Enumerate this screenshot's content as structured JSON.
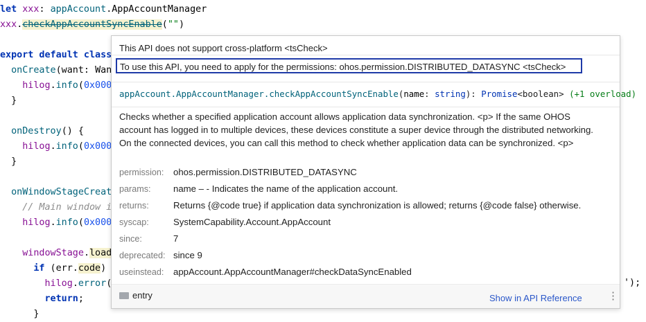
{
  "editor": {
    "lines": [
      {
        "id": "l1",
        "parts": [
          [
            "kw",
            "let "
          ],
          [
            "id",
            "xxx"
          ],
          [
            "plain",
            ": "
          ],
          [
            "fn",
            "appAccount"
          ],
          [
            "plain",
            "."
          ],
          [
            "cls",
            "AppAccountManager"
          ]
        ]
      },
      {
        "id": "l2",
        "parts": [
          [
            "id",
            "xxx"
          ],
          [
            "plain",
            "."
          ],
          [
            "deprecated",
            "checkAppAccountSyncEnable"
          ],
          [
            "plain",
            "("
          ],
          [
            "str",
            "\"\""
          ],
          [
            "plain",
            ")"
          ]
        ]
      },
      {
        "id": "l3",
        "parts": []
      },
      {
        "id": "l4",
        "parts": [
          [
            "kw",
            "export default class"
          ]
        ]
      },
      {
        "id": "l5",
        "parts": [
          [
            "plain",
            "  "
          ],
          [
            "fn",
            "onCreate"
          ],
          [
            "plain",
            "(want: "
          ],
          [
            "cls",
            "Wan"
          ]
        ]
      },
      {
        "id": "l6",
        "parts": [
          [
            "plain",
            "    "
          ],
          [
            "id",
            "hilog"
          ],
          [
            "plain",
            "."
          ],
          [
            "fn",
            "info"
          ],
          [
            "plain",
            "("
          ],
          [
            "num",
            "0x000"
          ]
        ]
      },
      {
        "id": "l7",
        "parts": [
          [
            "plain",
            "  }"
          ]
        ]
      },
      {
        "id": "l8",
        "parts": []
      },
      {
        "id": "l9",
        "parts": [
          [
            "plain",
            "  "
          ],
          [
            "fn",
            "onDestroy"
          ],
          [
            "plain",
            "() {"
          ]
        ]
      },
      {
        "id": "l10",
        "parts": [
          [
            "plain",
            "    "
          ],
          [
            "id",
            "hilog"
          ],
          [
            "plain",
            "."
          ],
          [
            "fn",
            "info"
          ],
          [
            "plain",
            "("
          ],
          [
            "num",
            "0x000"
          ]
        ]
      },
      {
        "id": "l11",
        "parts": [
          [
            "plain",
            "  }"
          ]
        ]
      },
      {
        "id": "l12",
        "parts": []
      },
      {
        "id": "l13",
        "parts": [
          [
            "plain",
            "  "
          ],
          [
            "fn",
            "onWindowStageCreat"
          ]
        ]
      },
      {
        "id": "l14",
        "parts": [
          [
            "plain",
            "    "
          ],
          [
            "cm",
            "// Main window i"
          ]
        ]
      },
      {
        "id": "l15",
        "parts": [
          [
            "plain",
            "    "
          ],
          [
            "id",
            "hilog"
          ],
          [
            "plain",
            "."
          ],
          [
            "fn",
            "info"
          ],
          [
            "plain",
            "("
          ],
          [
            "num",
            "0x000"
          ]
        ]
      },
      {
        "id": "l16",
        "parts": []
      },
      {
        "id": "l17",
        "parts": [
          [
            "plain",
            "    "
          ],
          [
            "id",
            "windowStage"
          ],
          [
            "plain",
            "."
          ],
          [
            "highlight",
            "load"
          ]
        ]
      },
      {
        "id": "l18",
        "parts": [
          [
            "plain",
            "      "
          ],
          [
            "kw",
            "if"
          ],
          [
            "plain",
            " (err."
          ],
          [
            "highlight",
            "code"
          ],
          [
            "plain",
            ")"
          ]
        ]
      },
      {
        "id": "l19",
        "parts": [
          [
            "plain",
            "        "
          ],
          [
            "id",
            "hilog"
          ],
          [
            "plain",
            "."
          ],
          [
            "fn",
            "error"
          ],
          [
            "plain",
            "("
          ]
        ]
      },
      {
        "id": "l20",
        "parts": [
          [
            "plain",
            "        "
          ],
          [
            "kw",
            "return"
          ],
          [
            "plain",
            ";"
          ]
        ]
      },
      {
        "id": "l21",
        "parts": [
          [
            "plain",
            "      }"
          ]
        ]
      }
    ],
    "overflow_text": "');"
  },
  "popup": {
    "warning_cross_platform": "This API does not support cross-platform <tsCheck>",
    "warning_permission": "To use this API, you need to apply for the permissions: ohos.permission.DISTRIBUTED_DATASYNC <tsCheck>",
    "signature": {
      "class": "appAccount.AppAccountManager.checkAppAccountSyncEnable",
      "open": "(",
      "param_name": "name",
      "colon": ": ",
      "param_type": "string",
      "close": "): ",
      "return_type": "Promise",
      "return_generic": "<boolean>",
      "overload": "(+1 overload)"
    },
    "description": "Checks whether a specified application account allows application data synchronization. <p> If the same OHOS account has logged in to multiple devices, these devices constitute a super device through the distributed networking. On the connected devices, you can call this method to check whether application data can be synchronized. <p>",
    "tags": [
      {
        "key": "permission:",
        "value": "ohos.permission.DISTRIBUTED_DATASYNC"
      },
      {
        "key": "params:",
        "value": "name – - Indicates the name of the application account."
      },
      {
        "key": "returns:",
        "value": "Returns {@code true} if application data synchronization is allowed; returns {@code false} otherwise."
      },
      {
        "key": "syscap:",
        "value": "SystemCapability.Account.AppAccount"
      },
      {
        "key": "since:",
        "value": "7"
      },
      {
        "key": "deprecated:",
        "value": "since 9"
      },
      {
        "key": "useinstead:",
        "value": "appAccount.AppAccountManager#checkDataSyncEnabled"
      }
    ],
    "footer": {
      "module": "entry",
      "api_reference": "Show in API Reference",
      "more_icon": "⋮"
    }
  }
}
